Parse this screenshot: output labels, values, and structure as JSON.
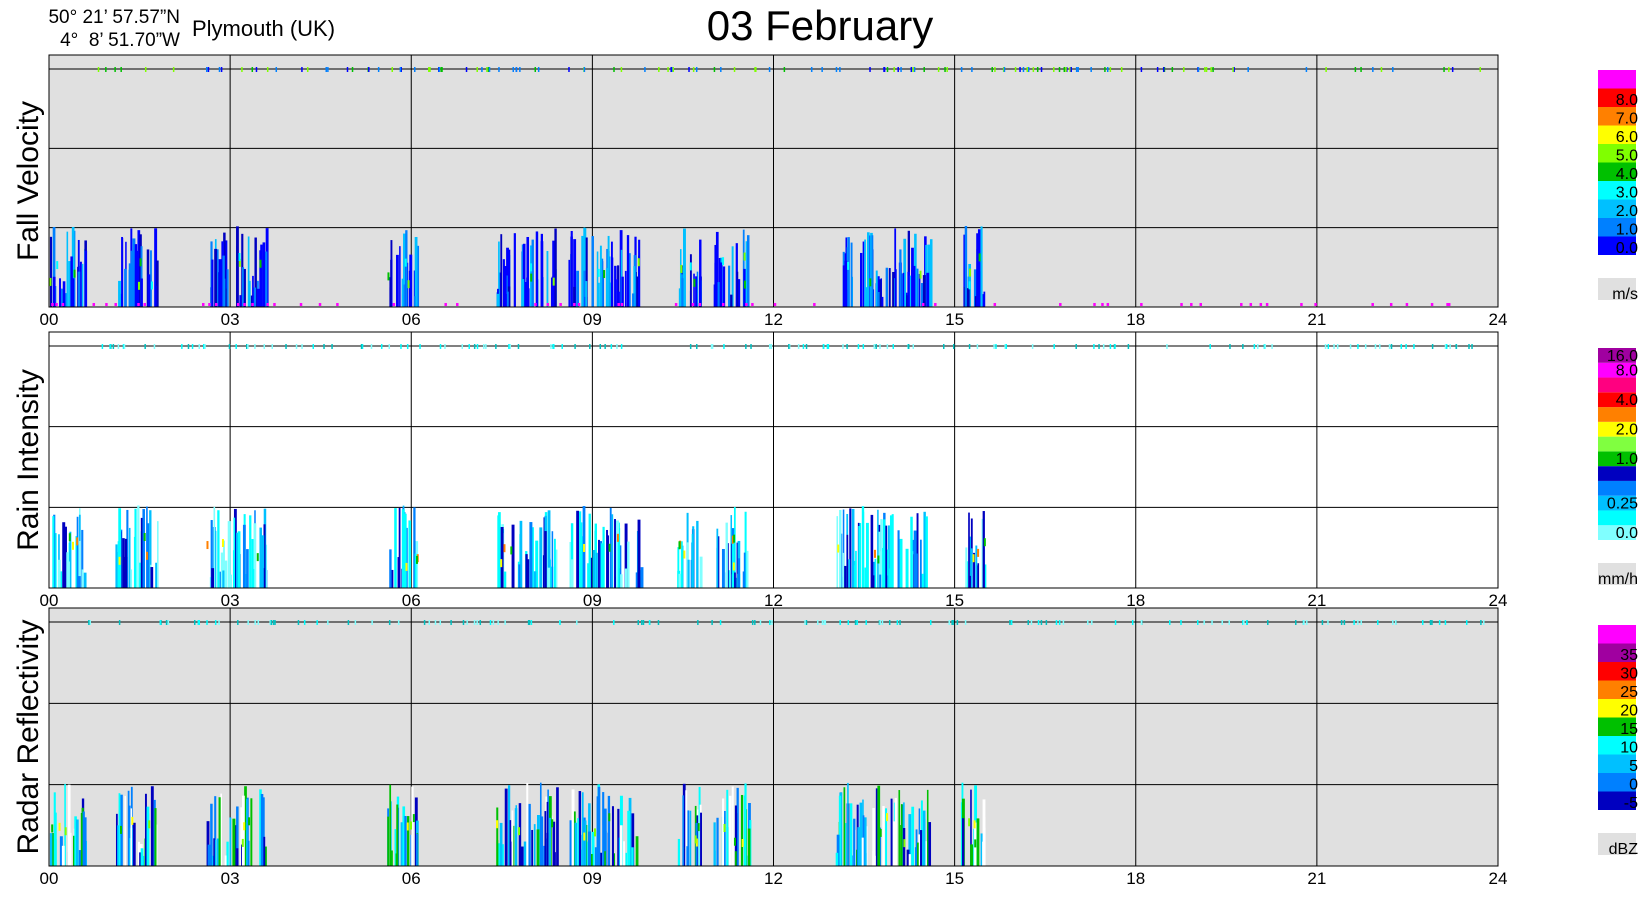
{
  "header": {
    "lat": "50° 21’ 57.57”N",
    "lon": "4°  8’ 51.70”W",
    "location": "Plymouth (UK)",
    "title": "03 February"
  },
  "chart_data": [
    {
      "type": "heatmap",
      "ylabel": "Fall Velocity",
      "unit": "m/s",
      "background": "#e0e0e0",
      "x_ticks": [
        "00",
        "03",
        "06",
        "09",
        "12",
        "15",
        "18",
        "21",
        "24"
      ],
      "xlim": [
        0,
        24
      ],
      "legend": [
        {
          "label": "0.0",
          "color": "#0000ff"
        },
        {
          "label": "1.0",
          "color": "#0080ff"
        },
        {
          "label": "2.0",
          "color": "#00c0ff"
        },
        {
          "label": "3.0",
          "color": "#00ffff"
        },
        {
          "label": "4.0",
          "color": "#00c000"
        },
        {
          "label": "5.0",
          "color": "#80ff00"
        },
        {
          "label": "6.0",
          "color": "#ffff00"
        },
        {
          "label": "7.0",
          "color": "#ff8000"
        },
        {
          "label": "8.0",
          "color": "#ff0000"
        },
        {
          "label": "",
          "color": "#ff00ff"
        }
      ],
      "rain_periods_h": [
        [
          0.0,
          0.6
        ],
        [
          1.1,
          1.8
        ],
        [
          2.6,
          3.6
        ],
        [
          5.6,
          6.1
        ],
        [
          7.4,
          8.4
        ],
        [
          8.6,
          9.8
        ],
        [
          10.4,
          10.8
        ],
        [
          11.0,
          11.6
        ],
        [
          13.0,
          14.6
        ],
        [
          15.1,
          15.5
        ]
      ]
    },
    {
      "type": "heatmap",
      "ylabel": "Rain Intensity",
      "unit": "mm/h",
      "background": "#ffffff",
      "x_ticks": [
        "00",
        "03",
        "06",
        "09",
        "12",
        "15",
        "18",
        "21",
        "24"
      ],
      "xlim": [
        0,
        24
      ],
      "legend": [
        {
          "label": "0.0",
          "color": "#80ffff"
        },
        {
          "label": "",
          "color": "#00ffff"
        },
        {
          "label": "0.25",
          "color": "#00c0ff"
        },
        {
          "label": "",
          "color": "#0080ff"
        },
        {
          "label": "",
          "color": "#0000c0"
        },
        {
          "label": "1.0",
          "color": "#00c000"
        },
        {
          "label": "",
          "color": "#80ff40"
        },
        {
          "label": "2.0",
          "color": "#ffff00"
        },
        {
          "label": "",
          "color": "#ff8000"
        },
        {
          "label": "4.0",
          "color": "#ff0000"
        },
        {
          "label": "",
          "color": "#ff0080"
        },
        {
          "label": "8.0",
          "color": "#ff00ff"
        },
        {
          "label": "16.0",
          "color": "#a000a0"
        }
      ],
      "rain_periods_h": [
        [
          0.0,
          0.6
        ],
        [
          1.1,
          1.8
        ],
        [
          2.6,
          3.6
        ],
        [
          5.6,
          6.1
        ],
        [
          7.4,
          8.4
        ],
        [
          8.6,
          9.8
        ],
        [
          10.4,
          10.8
        ],
        [
          11.0,
          11.6
        ],
        [
          13.0,
          14.6
        ],
        [
          15.1,
          15.5
        ]
      ]
    },
    {
      "type": "heatmap",
      "ylabel": "Radar Reflectivity",
      "unit": "dBZ",
      "background": "#e0e0e0",
      "x_ticks": [
        "00",
        "03",
        "06",
        "09",
        "12",
        "15",
        "18",
        "21",
        "24"
      ],
      "xlim": [
        0,
        24
      ],
      "legend": [
        {
          "label": "-5",
          "color": "#0000c0"
        },
        {
          "label": "0",
          "color": "#0080ff"
        },
        {
          "label": "5",
          "color": "#00c0ff"
        },
        {
          "label": "10",
          "color": "#00ffff"
        },
        {
          "label": "15",
          "color": "#00c000"
        },
        {
          "label": "20",
          "color": "#ffff00"
        },
        {
          "label": "25",
          "color": "#ff8000"
        },
        {
          "label": "30",
          "color": "#ff0000"
        },
        {
          "label": "35",
          "color": "#a000a0"
        },
        {
          "label": "",
          "color": "#ff00ff"
        }
      ],
      "rain_periods_h": [
        [
          0.0,
          0.6
        ],
        [
          1.1,
          1.8
        ],
        [
          2.6,
          3.6
        ],
        [
          5.6,
          6.1
        ],
        [
          7.4,
          8.4
        ],
        [
          8.6,
          9.8
        ],
        [
          10.4,
          10.8
        ],
        [
          11.0,
          11.6
        ],
        [
          13.0,
          14.6
        ],
        [
          15.1,
          15.5
        ]
      ]
    }
  ]
}
